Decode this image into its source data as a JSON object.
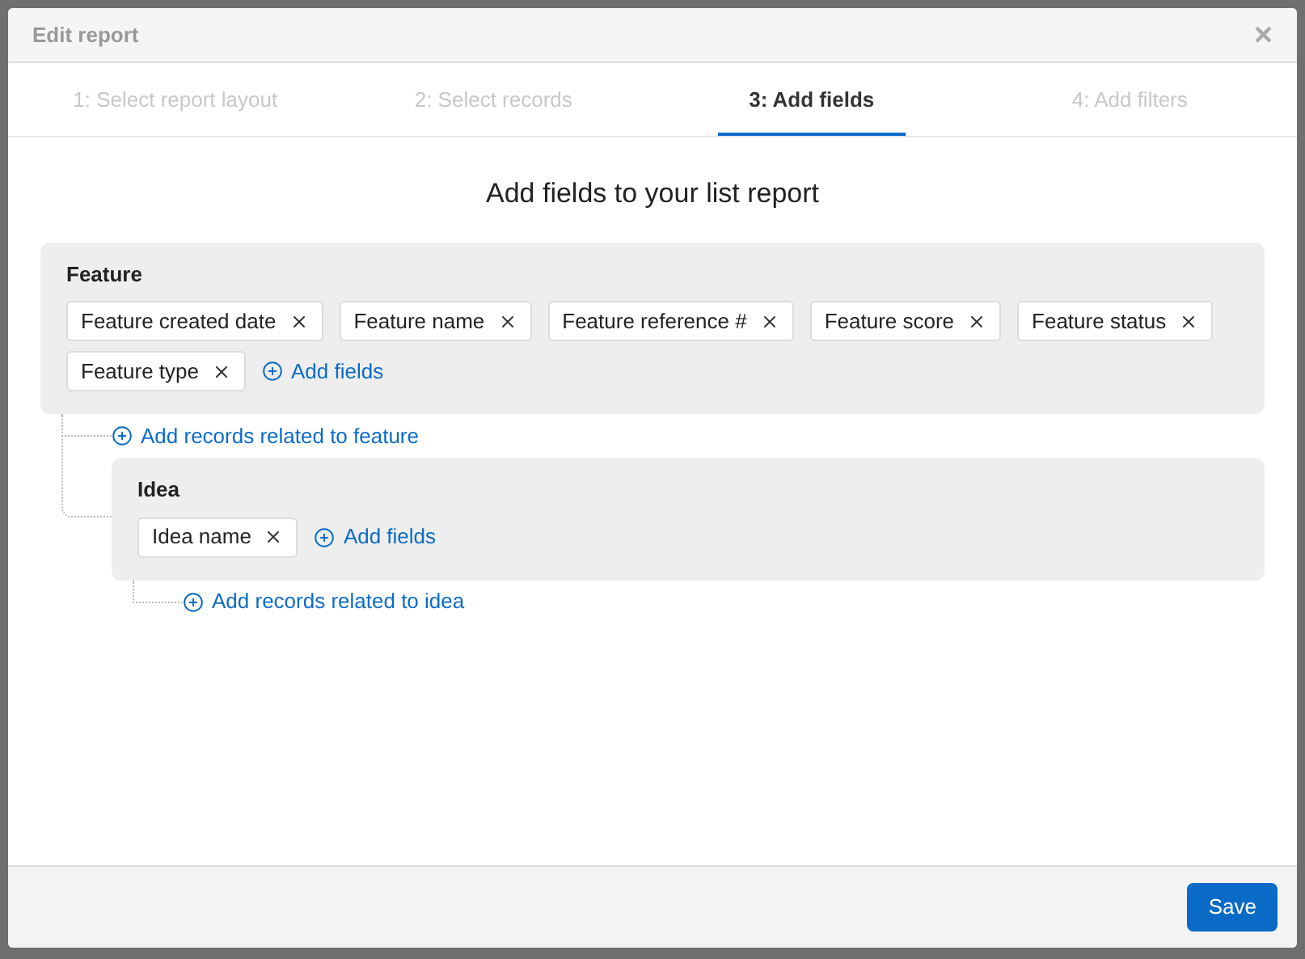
{
  "dialog": {
    "title": "Edit report",
    "close": "×"
  },
  "steps": [
    {
      "label": "1: Select report layout",
      "selected": false
    },
    {
      "label": "2: Select records",
      "selected": false
    },
    {
      "label": "3: Add fields",
      "selected": true
    },
    {
      "label": "4: Add filters",
      "selected": false
    }
  ],
  "heading": "Add fields to your list report",
  "record": {
    "name": "Feature",
    "fields": [
      "Feature created date",
      "Feature name",
      "Feature reference #",
      "Feature score",
      "Feature status",
      "Feature type"
    ],
    "add_fields": "Add fields",
    "add_related": "Add records related to feature",
    "children": [
      {
        "name": "Idea",
        "fields": [
          "Idea name"
        ],
        "add_fields": "Add fields",
        "add_related": "Add records related to idea"
      }
    ]
  },
  "footer": {
    "save": "Save"
  }
}
